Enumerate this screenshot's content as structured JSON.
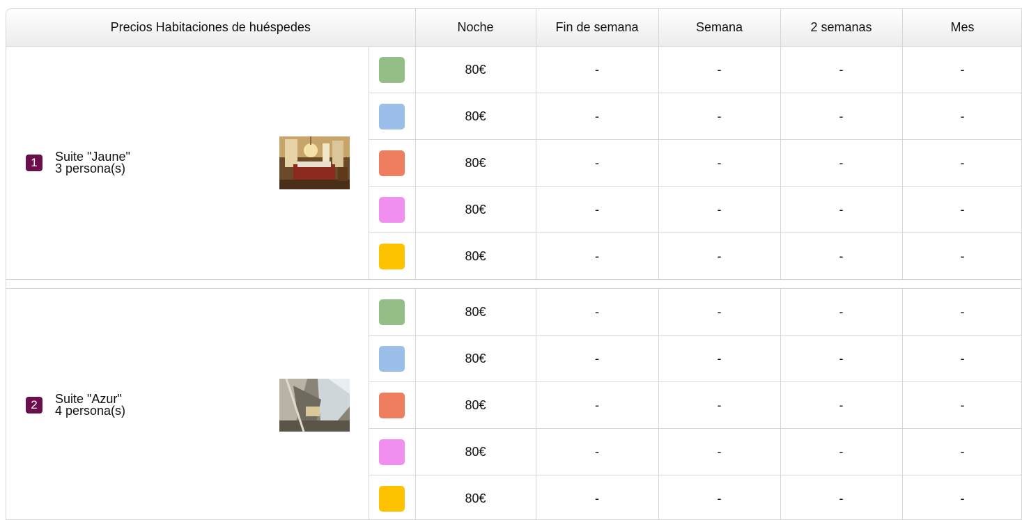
{
  "header": {
    "title": "Precios Habitaciones de huéspedes",
    "columns": [
      "Noche",
      "Fin de semana",
      "Semana",
      "2 semanas",
      "Mes"
    ]
  },
  "season_colors": [
    "#93be87",
    "#9cbfe9",
    "#ee7e5e",
    "#f08ff0",
    "#fec200"
  ],
  "rooms": [
    {
      "number": "1",
      "name": "Suite \"Jaune\"",
      "capacity": "3 persona(s)",
      "photo": "bedroom-chandelier-photo",
      "rates": [
        [
          "80€",
          "-",
          "-",
          "-",
          "-"
        ],
        [
          "80€",
          "-",
          "-",
          "-",
          "-"
        ],
        [
          "80€",
          "-",
          "-",
          "-",
          "-"
        ],
        [
          "80€",
          "-",
          "-",
          "-",
          "-"
        ],
        [
          "80€",
          "-",
          "-",
          "-",
          "-"
        ]
      ]
    },
    {
      "number": "2",
      "name": "Suite \"Azur\"",
      "capacity": "4 persona(s)",
      "photo": "attic-bedroom-photo",
      "rates": [
        [
          "80€",
          "-",
          "-",
          "-",
          "-"
        ],
        [
          "80€",
          "-",
          "-",
          "-",
          "-"
        ],
        [
          "80€",
          "-",
          "-",
          "-",
          "-"
        ],
        [
          "80€",
          "-",
          "-",
          "-",
          "-"
        ],
        [
          "80€",
          "-",
          "-",
          "-",
          "-"
        ]
      ]
    }
  ]
}
